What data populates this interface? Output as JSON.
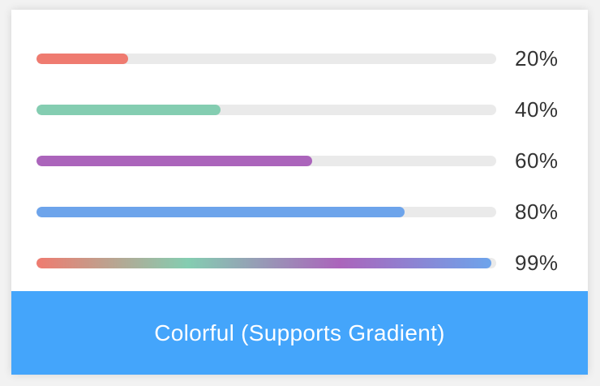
{
  "progress_bars": [
    {
      "label": "20%",
      "value": 0.2,
      "colors": [
        "#ef7b70"
      ]
    },
    {
      "label": "40%",
      "value": 0.4,
      "colors": [
        "#84cdb1"
      ]
    },
    {
      "label": "60%",
      "value": 0.6,
      "colors": [
        "#ab64bb"
      ]
    },
    {
      "label": "80%",
      "value": 0.8,
      "colors": [
        "#6da4eb"
      ]
    },
    {
      "label": "99%",
      "value": 0.99,
      "colors": [
        "#ef7b70",
        "#84cdb1",
        "#ab64bb",
        "#6da4eb"
      ]
    }
  ],
  "footer": {
    "button_label": "Colorful (Supports Gradient)",
    "background": "#44a5fb"
  }
}
